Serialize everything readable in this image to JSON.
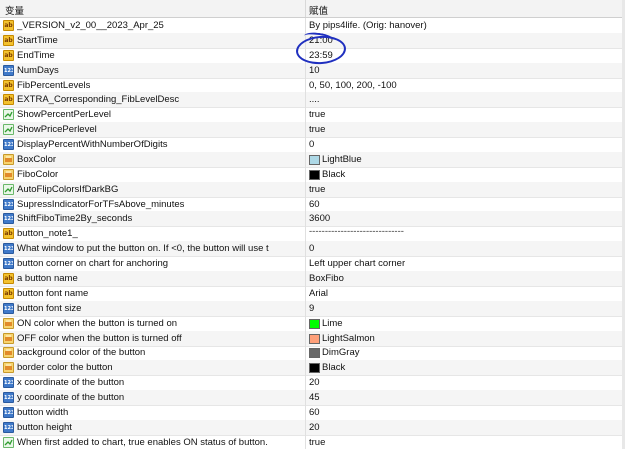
{
  "header": {
    "col_name": "变量",
    "col_value": "赋值"
  },
  "rows": [
    {
      "icon": "ab",
      "name": "_VERSION_v2_00__2023_Apr_25",
      "value": "By pips4life. (Orig: hanover)"
    },
    {
      "icon": "ab",
      "name": "StartTime",
      "value": "21:00"
    },
    {
      "icon": "ab",
      "name": "EndTime",
      "value": "23:59"
    },
    {
      "icon": "num",
      "name": "NumDays",
      "value": "10"
    },
    {
      "icon": "ab",
      "name": "FibPercentLevels",
      "value": "0, 50, 100, 200, -100"
    },
    {
      "icon": "ab",
      "name": "EXTRA_Corresponding_FibLevelDesc",
      "value": "...."
    },
    {
      "icon": "bool",
      "name": "ShowPercentPerLevel",
      "value": "true"
    },
    {
      "icon": "bool",
      "name": "ShowPricePerlevel",
      "value": "true"
    },
    {
      "icon": "num",
      "name": "DisplayPercentWithNumberOfDigits",
      "value": "0"
    },
    {
      "icon": "color",
      "name": "BoxColor",
      "value": "LightBlue",
      "swatch": "#add8e6"
    },
    {
      "icon": "color",
      "name": "FiboColor",
      "value": "Black",
      "swatch": "#000000"
    },
    {
      "icon": "bool",
      "name": "AutoFlipColorsIfDarkBG",
      "value": "true"
    },
    {
      "icon": "num",
      "name": "SupressIndicatorForTFsAbove_minutes",
      "value": "60"
    },
    {
      "icon": "num",
      "name": "ShiftFiboTime2By_seconds",
      "value": "3600"
    },
    {
      "icon": "ab",
      "name": "button_note1_",
      "value": "------------------------------",
      "dash": true
    },
    {
      "icon": "num",
      "name": "What window to put the button on.  If <0, the button will use t",
      "value": "0"
    },
    {
      "icon": "num",
      "name": "button corner on chart for anchoring",
      "value": "Left upper chart corner"
    },
    {
      "icon": "ab",
      "name": "a button name",
      "value": "BoxFibo"
    },
    {
      "icon": "ab",
      "name": "button font name",
      "value": "Arial"
    },
    {
      "icon": "num",
      "name": "button font size",
      "value": "9"
    },
    {
      "icon": "color",
      "name": "ON color when the button is turned on",
      "value": "Lime",
      "swatch": "#00ff00"
    },
    {
      "icon": "color",
      "name": "OFF color when the button is turned off",
      "value": "LightSalmon",
      "swatch": "#ffa07a"
    },
    {
      "icon": "color",
      "name": "background color of the button",
      "value": "DimGray",
      "swatch": "#696969"
    },
    {
      "icon": "color",
      "name": "border color the button",
      "value": "Black",
      "swatch": "#000000"
    },
    {
      "icon": "num",
      "name": "x coordinate of the button",
      "value": "20"
    },
    {
      "icon": "num",
      "name": "y coordinate of the button",
      "value": "45"
    },
    {
      "icon": "num",
      "name": "button width",
      "value": "60"
    },
    {
      "icon": "num",
      "name": "button height",
      "value": "20"
    },
    {
      "icon": "bool",
      "name": "When first added to chart, true enables ON status of button.",
      "value": "true"
    }
  ],
  "annotation": {
    "color": "#1f2fbf"
  }
}
